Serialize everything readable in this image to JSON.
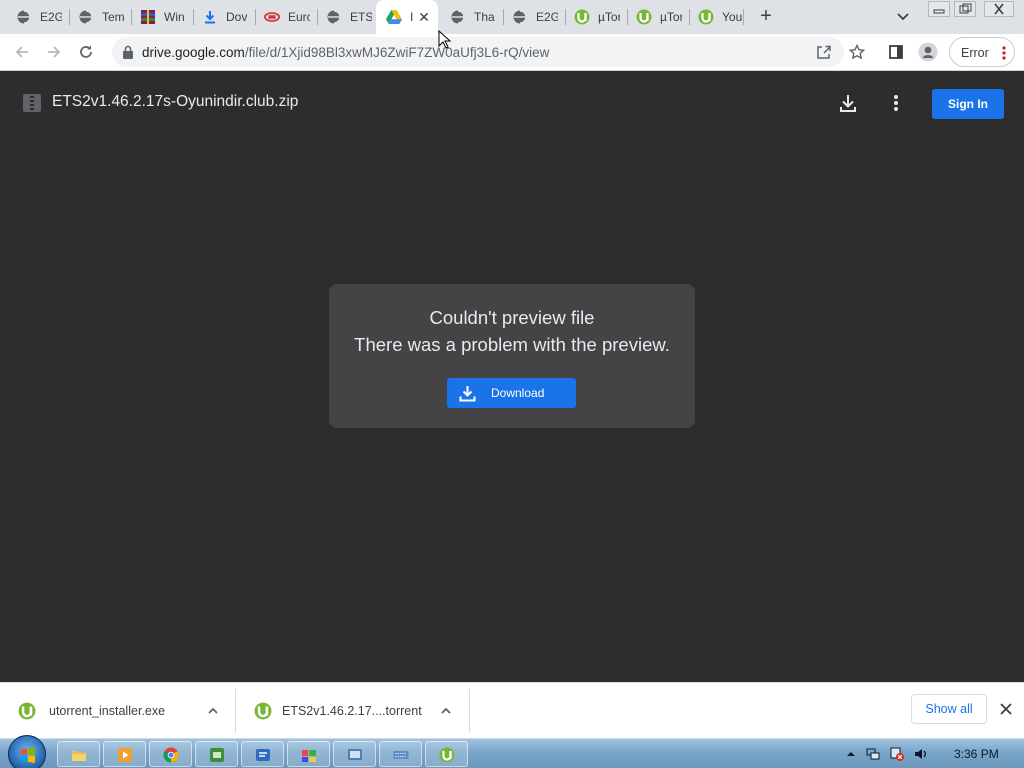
{
  "browser": {
    "tabs": [
      {
        "title": "E2G",
        "icon": "globe-icon"
      },
      {
        "title": "Tem",
        "icon": "globe-icon"
      },
      {
        "title": "Win",
        "icon": "winrar-icon"
      },
      {
        "title": "Dov",
        "icon": "download-arrow-icon"
      },
      {
        "title": "Eurc",
        "icon": "truck-game-icon"
      },
      {
        "title": "ETS",
        "icon": "globe-icon"
      },
      {
        "title": "I",
        "icon": "google-drive-icon",
        "active": true
      },
      {
        "title": "Tha",
        "icon": "globe-icon"
      },
      {
        "title": "E2G",
        "icon": "globe-icon"
      },
      {
        "title": "µTor",
        "icon": "utorrent-icon"
      },
      {
        "title": "µTor",
        "icon": "utorrent-icon"
      },
      {
        "title": "You",
        "icon": "utorrent-icon"
      }
    ],
    "url_host": "drive.google.com",
    "url_path": "/file/d/1Xjid98Bl3xwMJ6ZwiF7ZW0aUfj3L6-rQ/view",
    "profile_status": "Error"
  },
  "viewer": {
    "filename": "ETS2v1.46.2.17s-Oyunindir.club.zip",
    "signin_label": "Sign In",
    "error_title": "Couldn't preview file",
    "error_message": "There was a problem with the preview.",
    "download_label": "Download"
  },
  "downloads": {
    "items": [
      {
        "name": "utorrent_installer.exe",
        "icon": "utorrent-icon"
      },
      {
        "name": "ETS2v1.46.2.17....torrent",
        "icon": "utorrent-icon"
      }
    ],
    "show_all_label": "Show all"
  },
  "taskbar": {
    "clock": "3:36 PM",
    "apps": [
      "explorer-icon",
      "media-player-icon",
      "chrome-icon",
      "app-icon",
      "app-icon",
      "app-icon",
      "app-icon",
      "keyboard-icon",
      "utorrent-icon"
    ]
  },
  "colors": {
    "accent": "#1a73e8",
    "viewer_bg": "#2d2d2d",
    "dialog_bg": "#444446",
    "utorrent_green": "#78b636"
  }
}
